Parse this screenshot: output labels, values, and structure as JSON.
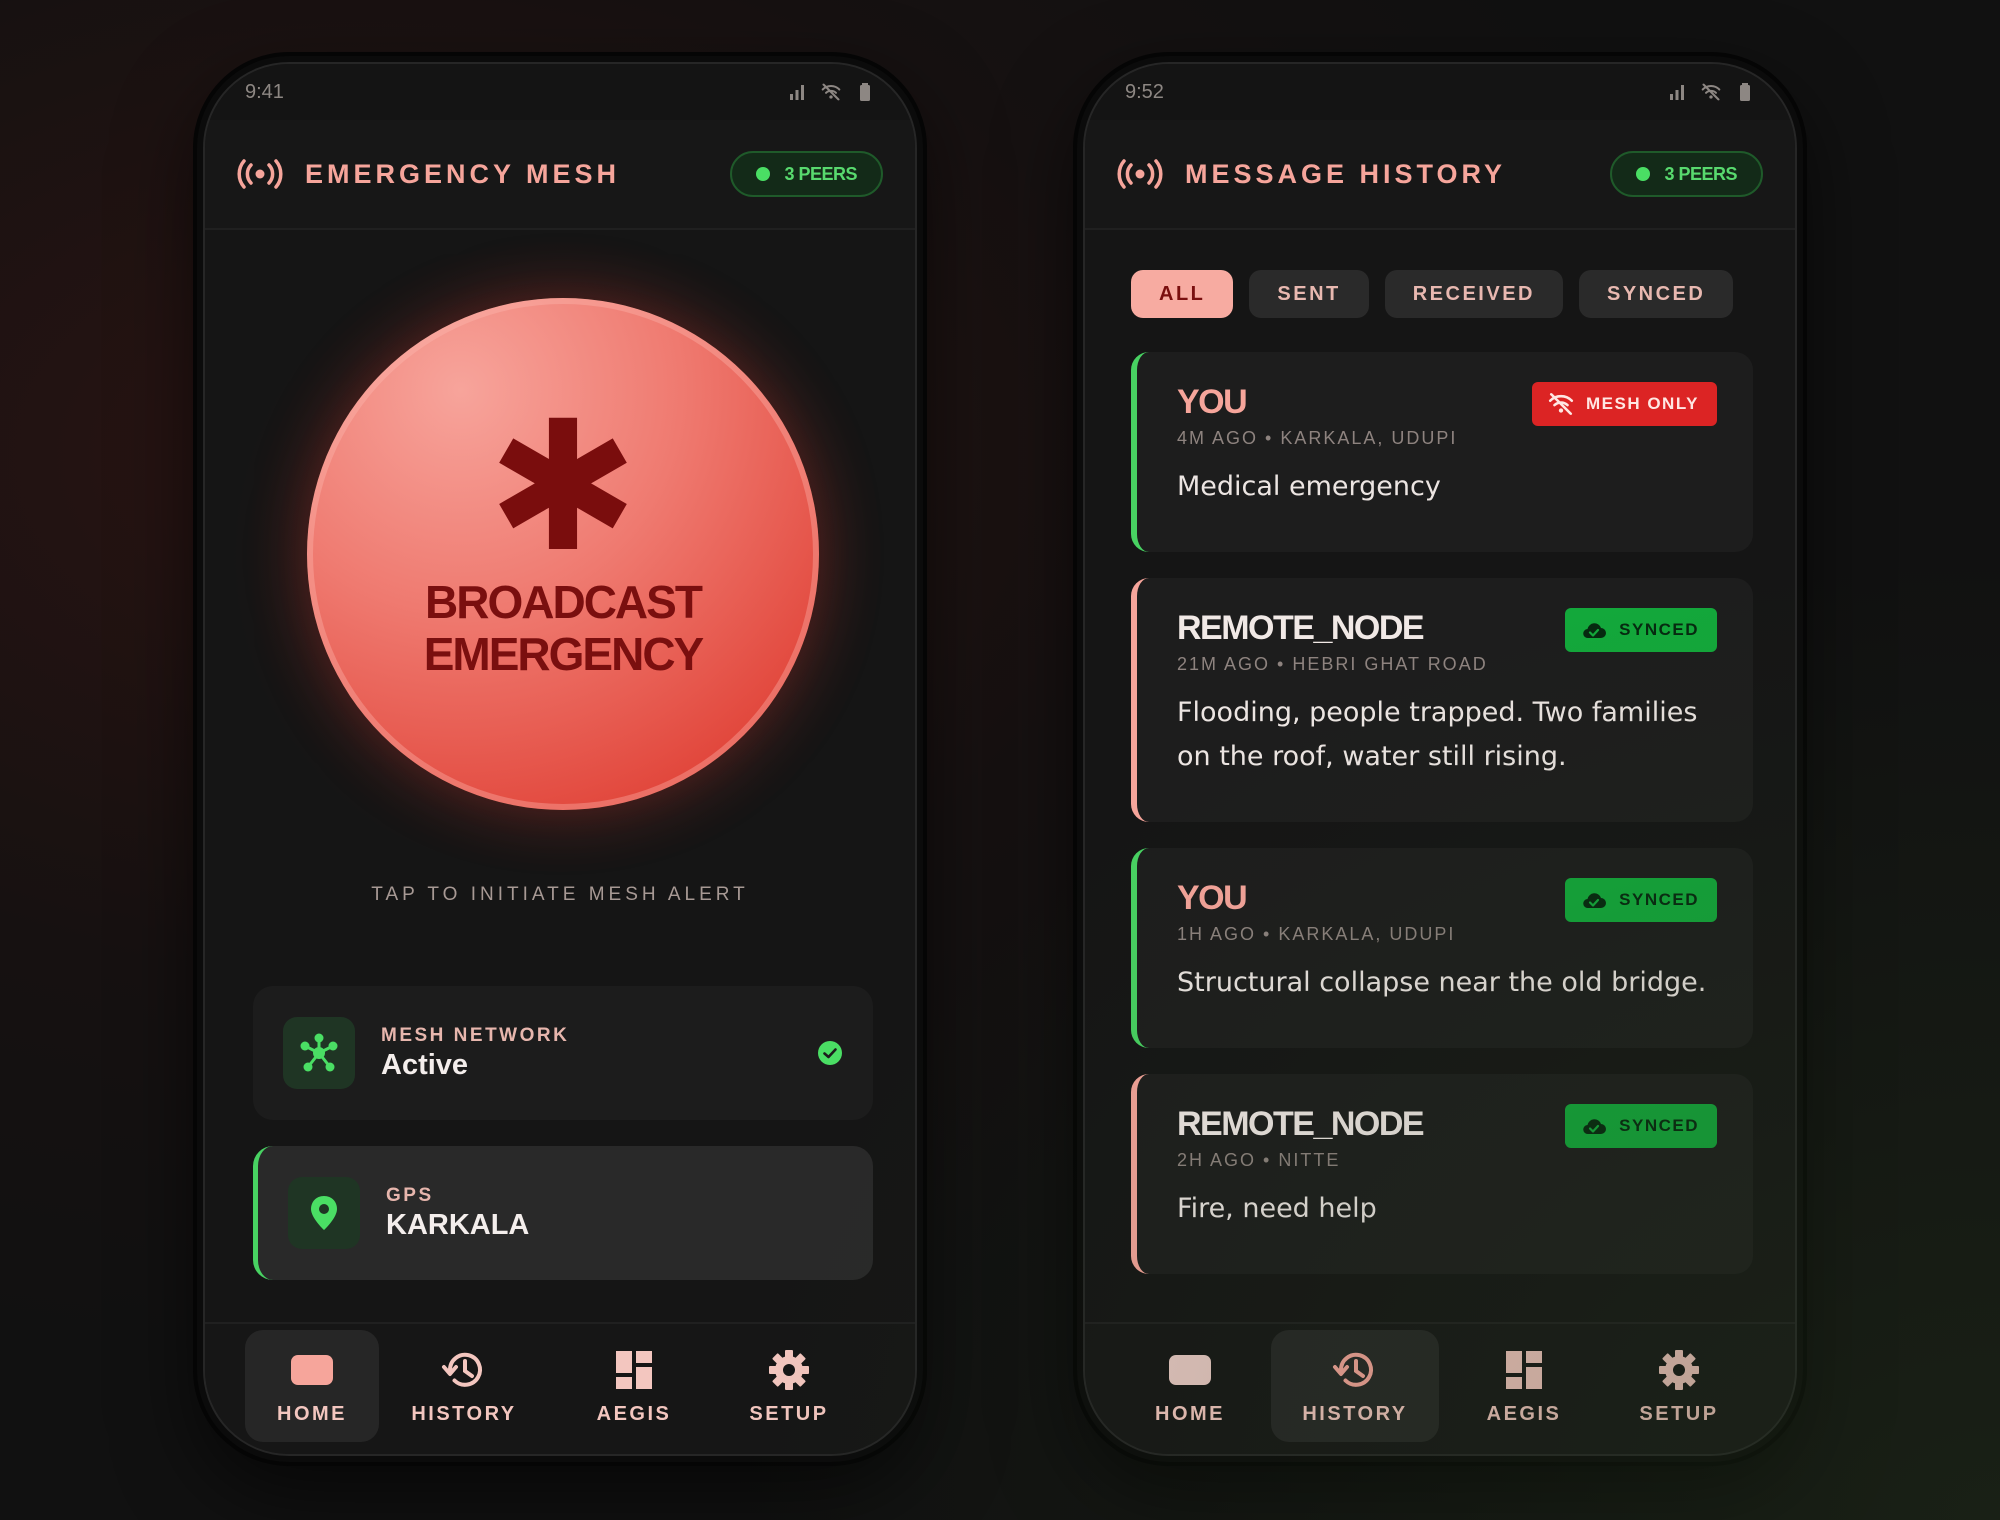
{
  "colors": {
    "accent": "#f6a59b",
    "success": "#48d262",
    "danger": "#dc2424",
    "background": "#151515"
  },
  "left": {
    "status": {
      "time": "9:41"
    },
    "header": {
      "title": "EMERGENCY MESH",
      "peers": "3 PEERS",
      "icon": "broadcast-icon"
    },
    "emergency": {
      "symbol": "✱",
      "label_line1": "BROADCAST",
      "label_line2": "EMERGENCY",
      "hint": "TAP TO INITIATE MESH ALERT"
    },
    "mesh_card": {
      "label": "MESH NETWORK",
      "value": "Active",
      "icon": "network-icon",
      "status_icon": "check-circle-icon"
    },
    "gps_card": {
      "label": "GPS",
      "value": "KARKALA",
      "icon": "location-pin-icon"
    },
    "nav": [
      {
        "label": "HOME",
        "icon": "home-icon",
        "active": true
      },
      {
        "label": "HISTORY",
        "icon": "history-icon",
        "active": false
      },
      {
        "label": "AEGIS",
        "icon": "dashboard-icon",
        "active": false
      },
      {
        "label": "SETUP",
        "icon": "gear-icon",
        "active": false
      }
    ]
  },
  "right": {
    "status": {
      "time": "9:52"
    },
    "header": {
      "title": "MESSAGE HISTORY",
      "peers": "3 PEERS",
      "icon": "broadcast-icon"
    },
    "filters": [
      {
        "label": "ALL",
        "active": true
      },
      {
        "label": "SENT",
        "active": false
      },
      {
        "label": "RECEIVED",
        "active": false
      },
      {
        "label": "SYNCED",
        "active": false
      }
    ],
    "messages": [
      {
        "sender": "YOU",
        "meta": "4M AGO • KARKALA, UDUPI",
        "body": "Medical emergency",
        "badge": "MESH ONLY",
        "badge_icon": "wifi-off-icon"
      },
      {
        "sender": "REMOTE_NODE",
        "meta": "21M AGO • HEBRI GHAT ROAD",
        "body": "Flooding, people trapped. Two families on the roof, water still rising.",
        "badge": "SYNCED",
        "badge_icon": "cloud-check-icon"
      },
      {
        "sender": "YOU",
        "meta": "1H AGO • KARKALA, UDUPI",
        "body": "Structural collapse near the old bridge.",
        "badge": "SYNCED",
        "badge_icon": "cloud-check-icon"
      },
      {
        "sender": "REMOTE_NODE",
        "meta": "2H AGO • NITTE",
        "body": "Fire, need help",
        "badge": "SYNCED",
        "badge_icon": "cloud-check-icon"
      }
    ],
    "nav": [
      {
        "label": "HOME",
        "icon": "home-icon",
        "active": false
      },
      {
        "label": "HISTORY",
        "icon": "history-icon",
        "active": true
      },
      {
        "label": "AEGIS",
        "icon": "dashboard-icon",
        "active": false
      },
      {
        "label": "SETUP",
        "icon": "gear-icon",
        "active": false
      }
    ]
  }
}
